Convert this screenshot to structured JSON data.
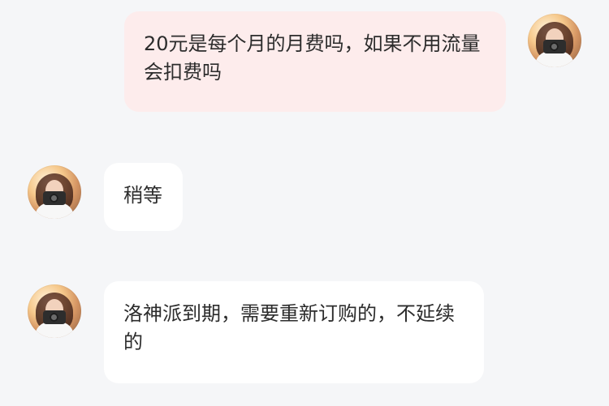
{
  "messages": [
    {
      "side": "right",
      "text": "20元是每个月的月费吗，如果不用流量会扣费吗",
      "avatar": "user-avatar"
    },
    {
      "side": "left",
      "text": "稍等",
      "avatar": "agent-avatar"
    },
    {
      "side": "left",
      "text": "洛神派到期，需要重新订购的，不延续的",
      "avatar": "agent-avatar"
    }
  ],
  "colors": {
    "background": "#f5f6f8",
    "outgoing_bubble": "#fdecec",
    "incoming_bubble": "#ffffff",
    "text": "#2c2c2c"
  }
}
